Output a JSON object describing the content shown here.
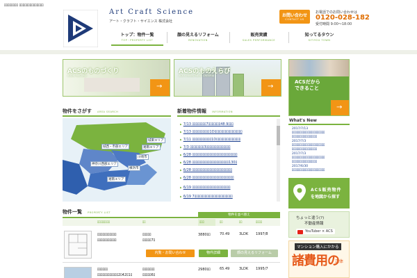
{
  "header": {
    "tagline": "ﾛﾛﾛﾛﾛﾛﾛﾛ ﾛﾛﾛﾛﾛﾛﾛﾛﾛﾛﾛﾛﾛﾛ",
    "brand": "Art Craft Science",
    "brand_sub": "アート・クラフト・サイエンス 株式会社",
    "contact_label": "お問い合わせ",
    "contact_sub": "CONTACT US",
    "phone_caption": "お電話でのお問い合わせは",
    "phone": "0120-028-182",
    "hours": "受付時間 9:00～18:00"
  },
  "nav": [
    {
      "jp": "トップ：物件一覧",
      "en": "TOP・PROPERTY LIST"
    },
    {
      "jp": "顔の見えるリフォーム",
      "en": "RENOVATION"
    },
    {
      "jp": "販売実績",
      "en": "SALES PERFORMANCE"
    },
    {
      "jp": "知ってるタウン",
      "en": "SITIYOU TOWN"
    }
  ],
  "banners": [
    {
      "title": "ACSのものづくり",
      "sub": "AUDIO RECORD"
    },
    {
      "title": "ACSのものえらび",
      "sub": "ACS'S INVESTMENT CRITERIA"
    }
  ],
  "right_banner": {
    "line1": "ACSだから",
    "line2": "できること"
  },
  "area_search": {
    "title": "物件をさがす",
    "en": "AREA SEARCH",
    "labels": [
      "城東エリア",
      "城西・市部エリア",
      "湘南エリア",
      "川崎市",
      "神奈川西部エリア",
      "横浜市",
      "湘南エリア"
    ]
  },
  "news": {
    "title": "新着物件情報",
    "en": "INFORMATION",
    "items": [
      {
        "date": "7/13",
        "text": "ﾛﾛﾛﾛﾛﾛﾛﾛ7ﾛﾛﾛﾛﾛﾛﾛ48.9ﾛﾛﾛ"
      },
      {
        "date": "7/13",
        "text": "ﾛﾛﾛﾛﾛﾛﾛﾛﾛﾛ1Dﾛﾛﾛﾛﾛﾛﾛﾛﾛﾛﾛﾛﾛﾛﾛﾛ"
      },
      {
        "date": "7/11",
        "text": "ﾛﾛﾛﾛﾛﾛﾛﾛﾛﾛﾛ1Dﾛﾛﾛﾛﾛﾛﾛﾛﾛﾛﾛﾛﾛﾛ"
      },
      {
        "date": "7/3",
        "text": "ﾛﾛﾛﾛﾛﾛﾛﾛ3ﾛﾛﾛﾛﾛﾛﾛﾛﾛﾛﾛﾛﾛﾛ"
      },
      {
        "date": "6/28",
        "text": "ﾛﾛﾛﾛﾛﾛﾛﾛﾛﾛﾛﾛﾛﾛﾛﾛﾛﾛﾛﾛﾛﾛﾛﾛﾛﾛ"
      },
      {
        "date": "6/28",
        "text": "ﾛﾛﾛﾛﾛﾛﾛﾛﾛﾛﾛﾛﾛﾛﾛﾛﾛﾛﾛﾛﾛ130ﾛ"
      },
      {
        "date": "6/28",
        "text": "ﾛﾛﾛﾛﾛﾛﾛﾛﾛﾛﾛﾛﾛﾛﾛﾛﾛﾛﾛﾛﾛﾛﾛ"
      },
      {
        "date": "6/28",
        "text": "ﾛﾛﾛﾛﾛﾛﾛﾛﾛﾛﾛﾛﾛﾛﾛﾛﾛﾛﾛﾛﾛﾛﾛﾛ"
      },
      {
        "date": "6/19",
        "text": "ﾛﾛﾛﾛﾛﾛﾛﾛﾛﾛﾛﾛﾛﾛﾛﾛﾛﾛﾛﾛﾛﾛ"
      },
      {
        "date": "6/19",
        "text": "7ﾛﾛﾛﾛﾛﾛﾛﾛﾛﾛﾛﾛﾛﾛﾛﾛﾛﾛﾛﾛﾛﾛ"
      }
    ]
  },
  "whats_new": {
    "title": "What's New",
    "items": [
      {
        "date": "2017/7/13",
        "text": "ﾛﾛﾛﾛﾛﾛﾛﾛﾛﾛﾛﾛﾛﾛﾛﾛﾛﾛﾛﾛﾛ",
        "text2": "ﾛﾛﾛﾛﾛﾛﾛﾛﾛﾛﾛﾛﾛﾛﾛﾛ"
      },
      {
        "date": "2017/7/3",
        "text": "ﾛﾛﾛﾛﾛﾛﾛﾛﾛﾛﾛﾛﾛﾛﾛﾛﾛﾛﾛﾛﾛ",
        "text2": "ﾛﾛﾛﾛﾛﾛﾛﾛﾛﾛﾛﾛﾛﾛﾛﾛ"
      },
      {
        "date": "2017/7/3",
        "text": "ﾛﾛﾛﾛﾛﾛﾛﾛﾛﾛﾛﾛﾛﾛﾛﾛﾛﾛﾛﾛﾛ",
        "text2": "ﾛﾛﾛﾛﾛﾛﾛﾛﾛﾛﾛﾛﾛﾛﾛﾛ"
      },
      {
        "date": "2017/6/30",
        "text": "ﾛﾛﾛﾛﾛﾛﾛﾛﾛﾛﾛﾛﾛﾛﾛﾛﾛﾛﾛﾛﾛ",
        "text2": "ﾛﾛﾛﾛﾛﾛﾛﾛﾛﾛﾛﾛﾛﾛﾛﾛ"
      }
    ]
  },
  "map_banner": {
    "line1": "ACS販売物件",
    "line2": "を地図から探す"
  },
  "youtube_banner": {
    "line1": "ちょっと違う(?)",
    "line2": "不動産情報",
    "label": "YouTuber × ACS"
  },
  "cost_banner": {
    "line1": "マンション購入にかかる",
    "line2": "諸費用の",
    "line3": "正体"
  },
  "property_list": {
    "title": "物件一覧",
    "en": "PROPERTY LIST",
    "sort_label": "物件を並べ替え",
    "headers": [
      "ﾛﾛﾛﾛﾛﾛﾛﾛ",
      "ﾛﾛ",
      "ﾛﾛﾛ",
      "ﾛﾛ",
      "ﾛﾛ",
      "ﾛﾛﾛﾛ"
    ],
    "rows": [
      {
        "name": "ﾛﾛﾛﾛﾛﾛﾛﾛﾛﾛﾛ",
        "name2": "ﾛﾛﾛﾛﾛﾛﾛﾛﾛﾛﾛ",
        "loc": "ﾛﾛﾛﾛﾛ",
        "loc2": "ﾛﾛﾛﾛﾛ7ﾛ",
        "price": "3880ﾛﾛ",
        "area": "70.49",
        "layout": "3LDK",
        "year": "1997/8",
        "inquiry_button": "内覧・お問い合わせ",
        "detail_button": "物件詳細",
        "reform_button": "顔の見えるリフォーム"
      },
      {
        "name": "ﾛﾛﾛﾛﾛﾛ",
        "name2": "ﾛﾛﾛﾛﾛﾛﾛﾛﾛﾛﾛﾛ2ﾛ42ﾛ1ﾛ",
        "loc": "ﾛﾛﾛﾛﾛﾛﾛ",
        "loc2": "ﾛﾛﾛﾛﾛ6ﾛ",
        "price": "2980ﾛﾛ",
        "area": "65.49",
        "layout": "3LDK",
        "year": "1995/7"
      }
    ]
  }
}
